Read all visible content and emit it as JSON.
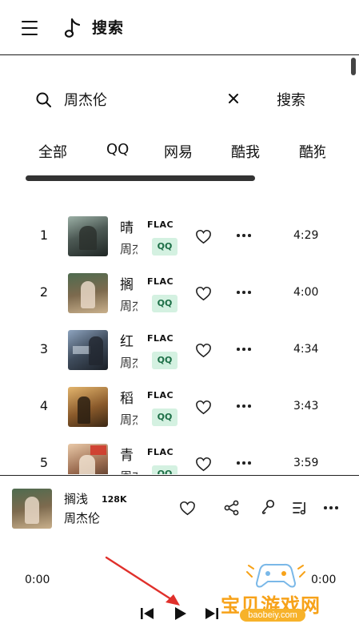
{
  "header": {
    "title": "搜索",
    "menu_icon": "hamburger-icon",
    "logo_icon": "music-note-icon"
  },
  "search": {
    "query": "周杰伦",
    "button_label": "搜索"
  },
  "tabs": [
    {
      "label": "全部"
    },
    {
      "label": "QQ"
    },
    {
      "label": "网易"
    },
    {
      "label": "酷我"
    },
    {
      "label": "酷狗"
    }
  ],
  "songs": [
    {
      "index": "1",
      "name": "晴",
      "artist": "周杰伦",
      "quality": "FLAC",
      "source": "QQ",
      "duration": "4:29",
      "cover_color": "#4d5a55"
    },
    {
      "index": "2",
      "name": "搁",
      "artist": "周杰伦",
      "quality": "FLAC",
      "source": "QQ",
      "duration": "4:00",
      "cover_color": "#7d6a4e"
    },
    {
      "index": "3",
      "name": "红",
      "artist": "周杰伦",
      "quality": "FLAC",
      "source": "QQ",
      "duration": "4:34",
      "cover_color": "#3f4c5c"
    },
    {
      "index": "4",
      "name": "稻",
      "artist": "周杰伦",
      "quality": "FLAC",
      "source": "QQ",
      "duration": "3:43",
      "cover_color": "#8a5a2b"
    },
    {
      "index": "5",
      "name": "青",
      "artist": "周杰伦",
      "quality": "FLAC",
      "source": "QQ",
      "duration": "3:59",
      "cover_color": "#9a6b4f"
    }
  ],
  "player": {
    "title": "搁浅",
    "quality": "128K",
    "artist": "周杰伦",
    "time_current": "0:00",
    "time_total": "0:00"
  },
  "watermark": {
    "text": "宝贝游戏网",
    "sub": "baobeiy.com"
  },
  "colors": {
    "badge_bg": "#d4f1e1",
    "badge_text": "#1d6f47",
    "annotation_arrow": "#e0302b",
    "watermark": "#f7a219"
  }
}
